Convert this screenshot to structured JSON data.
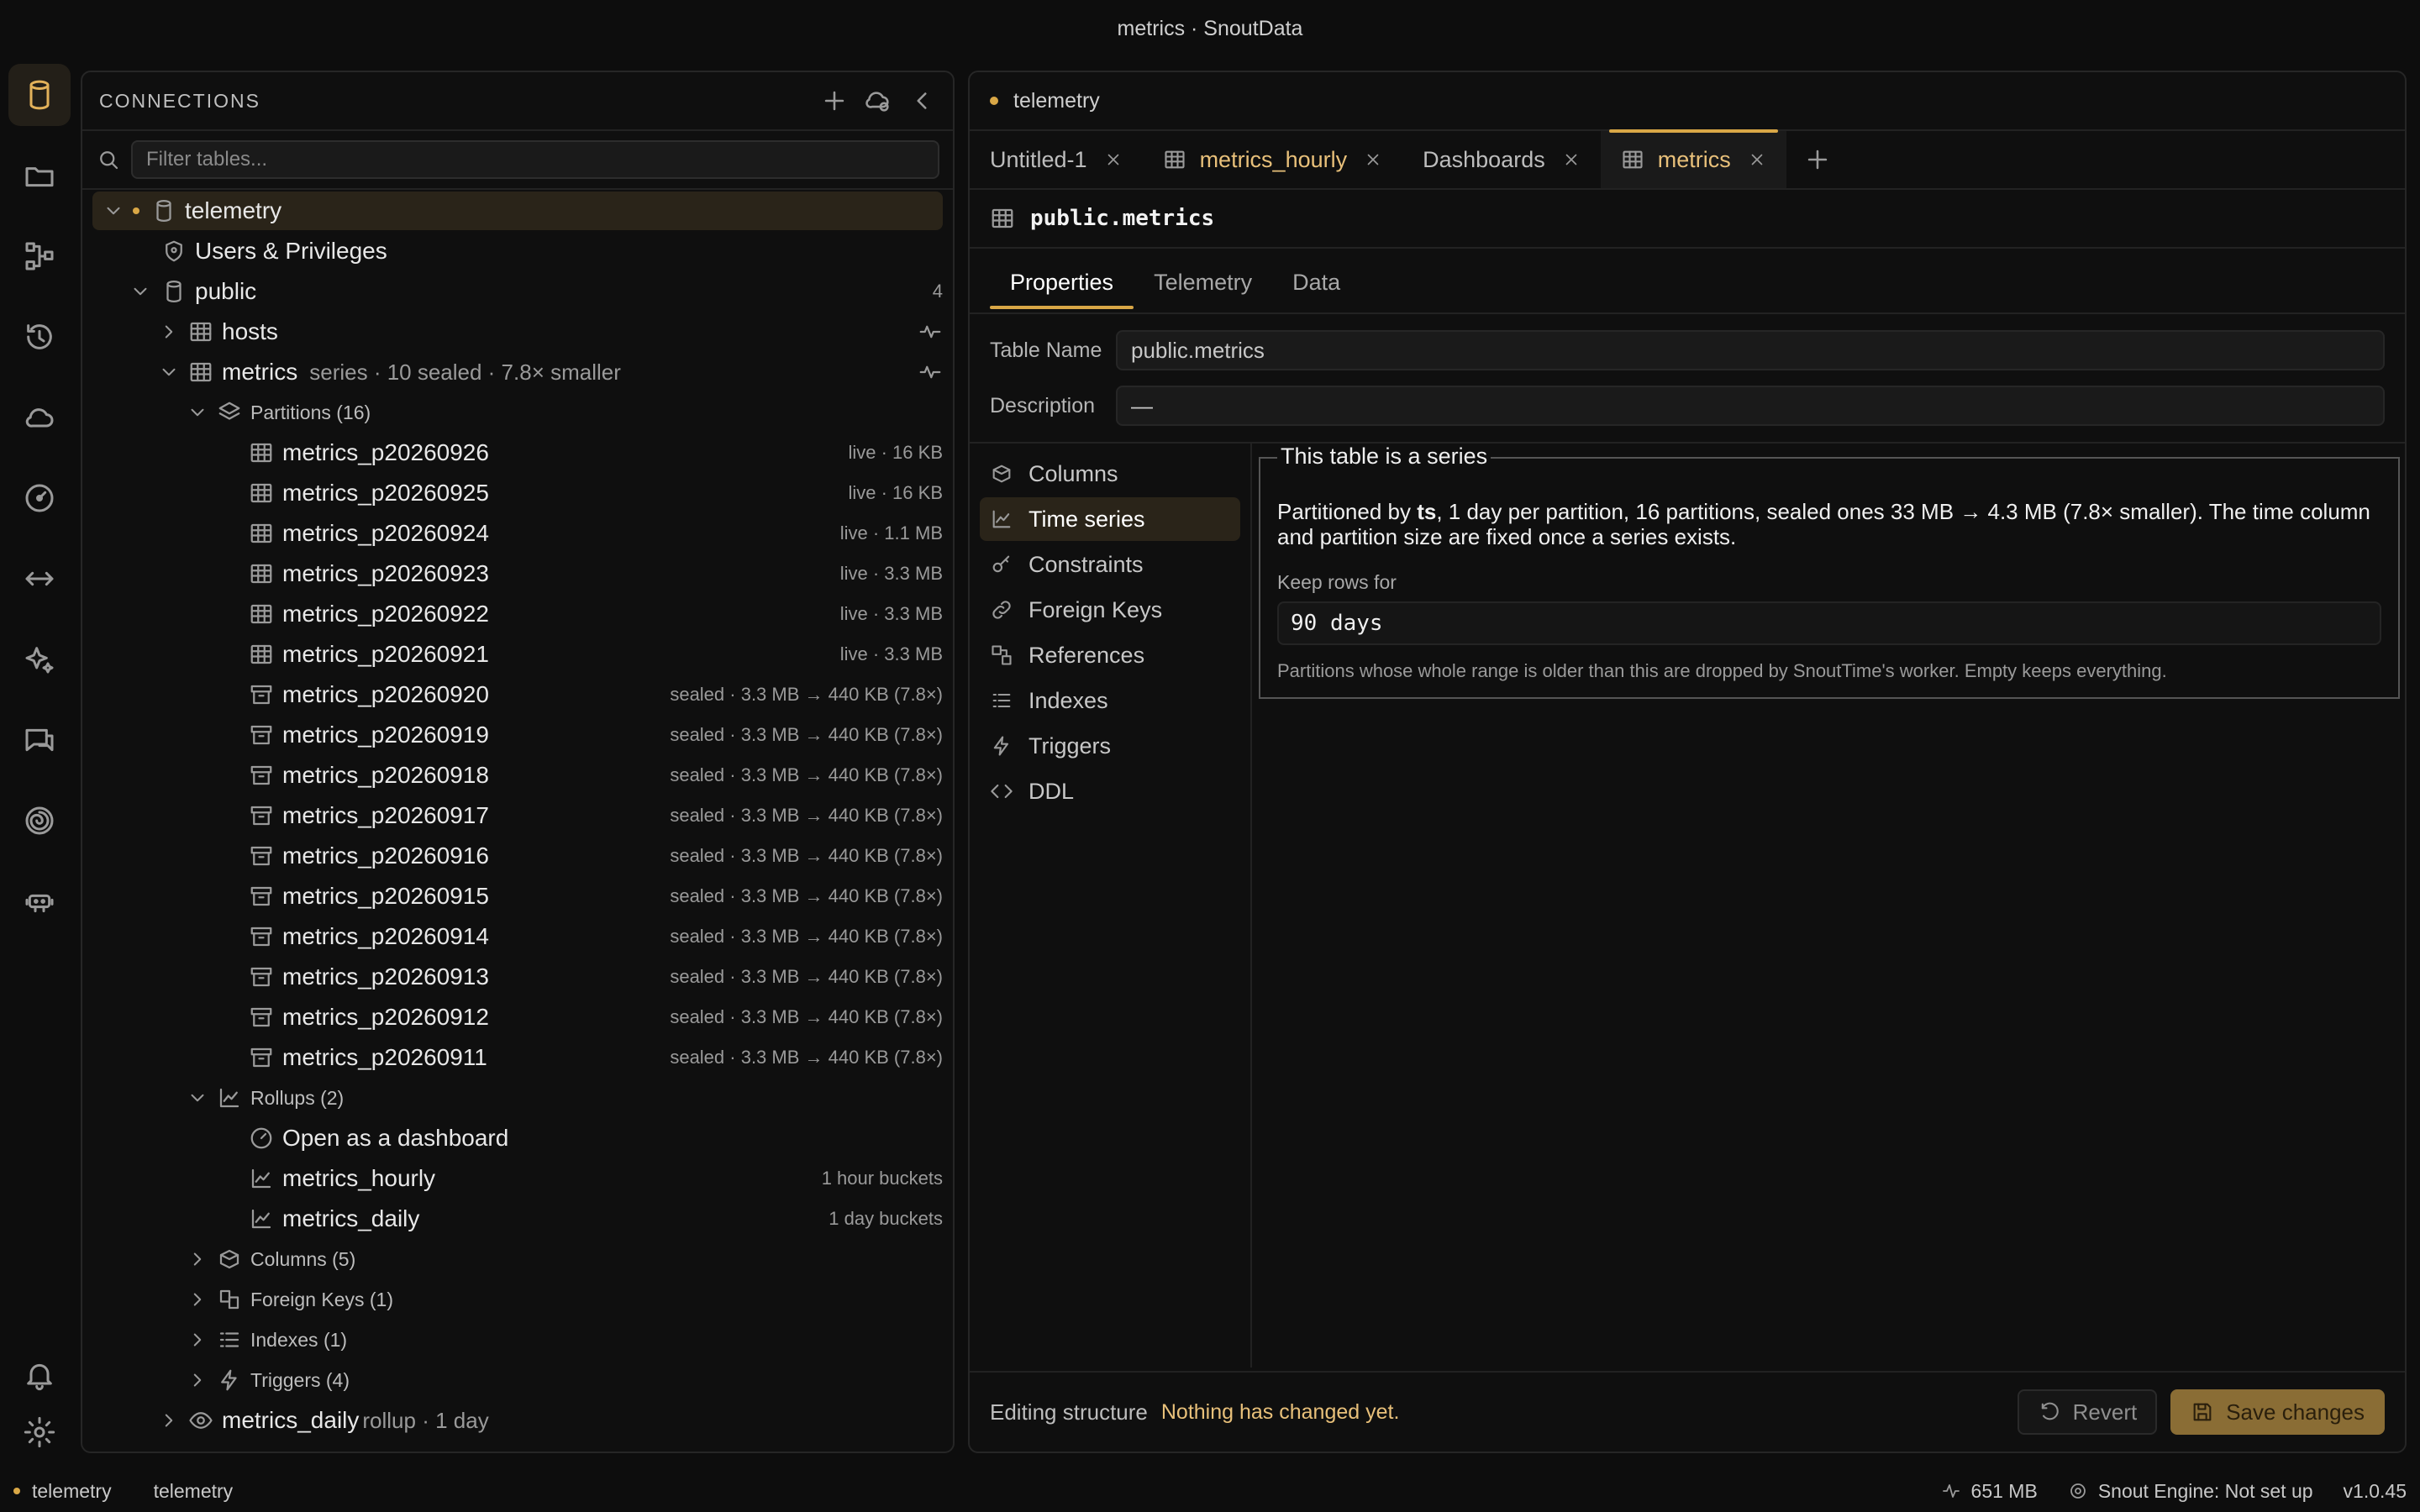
{
  "window": {
    "title": "metrics · SnoutData"
  },
  "rail": {
    "items": [
      "database-icon",
      "folder-icon",
      "schema-icon",
      "history-icon",
      "cloud-icon",
      "gauge-icon",
      "transfer-icon",
      "sparkles-icon",
      "chat-icon",
      "spiral-icon",
      "robot-icon"
    ],
    "bottom": [
      "bell-icon",
      "gear-icon"
    ]
  },
  "connections": {
    "title": "CONNECTIONS",
    "filter_placeholder": "Filter tables...",
    "tree": {
      "connection": "telemetry",
      "users": "Users & Privileges",
      "schema": "public",
      "schema_count": "4",
      "hosts": "hosts",
      "metrics": {
        "name": "metrics",
        "meta": "series · 10 sealed · 7.8× smaller"
      },
      "partitions_label": "Partitions (16)",
      "partitions": [
        {
          "name": "metrics_p20260926",
          "info": "live · 16 KB",
          "sealed": false
        },
        {
          "name": "metrics_p20260925",
          "info": "live · 16 KB",
          "sealed": false
        },
        {
          "name": "metrics_p20260924",
          "info": "live · 1.1 MB",
          "sealed": false
        },
        {
          "name": "metrics_p20260923",
          "info": "live · 3.3 MB",
          "sealed": false
        },
        {
          "name": "metrics_p20260922",
          "info": "live · 3.3 MB",
          "sealed": false
        },
        {
          "name": "metrics_p20260921",
          "info": "live · 3.3 MB",
          "sealed": false
        },
        {
          "name": "metrics_p20260920",
          "info": "sealed · 3.3 MB → 440 KB (7.8×)",
          "sealed": true
        },
        {
          "name": "metrics_p20260919",
          "info": "sealed · 3.3 MB → 440 KB (7.8×)",
          "sealed": true
        },
        {
          "name": "metrics_p20260918",
          "info": "sealed · 3.3 MB → 440 KB (7.8×)",
          "sealed": true
        },
        {
          "name": "metrics_p20260917",
          "info": "sealed · 3.3 MB → 440 KB (7.8×)",
          "sealed": true
        },
        {
          "name": "metrics_p20260916",
          "info": "sealed · 3.3 MB → 440 KB (7.8×)",
          "sealed": true
        },
        {
          "name": "metrics_p20260915",
          "info": "sealed · 3.3 MB → 440 KB (7.8×)",
          "sealed": true
        },
        {
          "name": "metrics_p20260914",
          "info": "sealed · 3.3 MB → 440 KB (7.8×)",
          "sealed": true
        },
        {
          "name": "metrics_p20260913",
          "info": "sealed · 3.3 MB → 440 KB (7.8×)",
          "sealed": true
        },
        {
          "name": "metrics_p20260912",
          "info": "sealed · 3.3 MB → 440 KB (7.8×)",
          "sealed": true
        },
        {
          "name": "metrics_p20260911",
          "info": "sealed · 3.3 MB → 440 KB (7.8×)",
          "sealed": true
        }
      ],
      "rollups_label": "Rollups (2)",
      "rollups": [
        {
          "name": "Open as a dashboard",
          "info": ""
        },
        {
          "name": "metrics_hourly",
          "info": "1 hour buckets"
        },
        {
          "name": "metrics_daily",
          "info": "1 day buckets"
        }
      ],
      "columns_label": "Columns (5)",
      "fk_label": "Foreign Keys (1)",
      "indexes_label": "Indexes (1)",
      "triggers_label": "Triggers (4)",
      "metrics_daily": {
        "name": "metrics_daily",
        "meta": "rollup · 1 day"
      }
    }
  },
  "editor": {
    "connection": "telemetry",
    "tabs": [
      {
        "label": "Untitled-1",
        "icon": "",
        "state": "normal"
      },
      {
        "label": "metrics_hourly",
        "icon": "table-icon",
        "state": "gold"
      },
      {
        "label": "Dashboards",
        "icon": "",
        "state": "normal"
      },
      {
        "label": "metrics",
        "icon": "table-icon",
        "state": "active"
      }
    ],
    "object_title": "public.metrics",
    "subtabs": [
      "Properties",
      "Telemetry",
      "Data"
    ],
    "table_name_label": "Table Name",
    "table_name_value": "public.metrics",
    "description_label": "Description",
    "description_value": "—",
    "side_nav": [
      {
        "label": "Columns",
        "icon": "columns-icon"
      },
      {
        "label": "Time series",
        "icon": "chart-icon"
      },
      {
        "label": "Constraints",
        "icon": "key-icon"
      },
      {
        "label": "Foreign Keys",
        "icon": "link-icon"
      },
      {
        "label": "References",
        "icon": "references-icon"
      },
      {
        "label": "Indexes",
        "icon": "list-icon"
      },
      {
        "label": "Triggers",
        "icon": "bolt-icon"
      },
      {
        "label": "DDL",
        "icon": "code-icon"
      }
    ],
    "series": {
      "legend": "This table is a series",
      "desc_pre": "Partitioned by ",
      "desc_bold": "ts",
      "desc_post": ", 1 day per partition, 16 partitions, sealed ones 33 MB → 4.3 MB (7.8× smaller). The time column and partition size are fixed once a series exists.",
      "keep_label": "Keep rows for",
      "keep_value": "90 days",
      "hint": "Partitions whose whole range is older than this are dropped by SnoutTime's worker. Empty keeps everything."
    },
    "footer": {
      "label": "Editing structure",
      "status": "Nothing has changed yet.",
      "revert": "Revert",
      "save": "Save changes"
    }
  },
  "statusbar": {
    "left1": "telemetry",
    "left2": "telemetry",
    "memory": "651 MB",
    "engine": "Snout Engine: Not set up",
    "version": "v1.0.45"
  }
}
